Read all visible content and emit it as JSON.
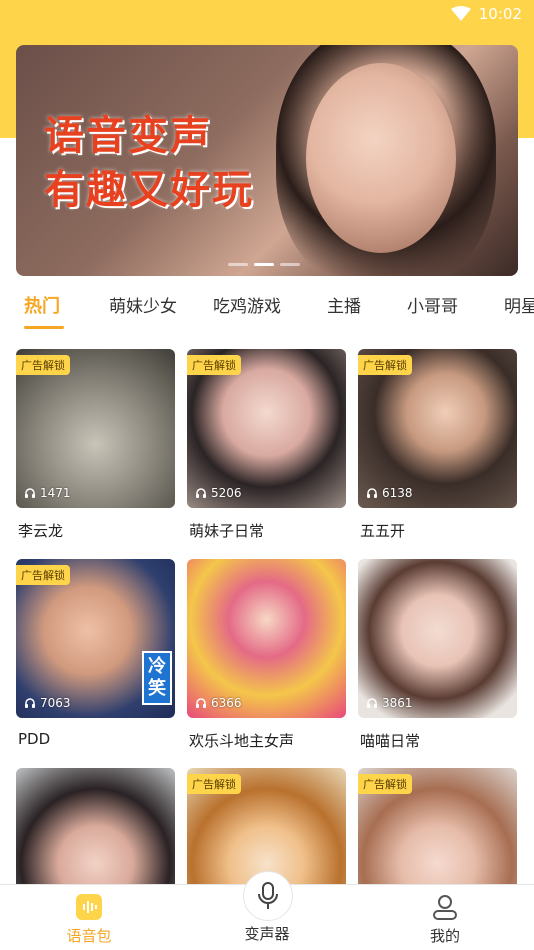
{
  "status_bar": {
    "time": "10:02"
  },
  "banner": {
    "line1": "语音变声",
    "line2": "有趣又好玩"
  },
  "tabs": [
    {
      "label": "热门",
      "active": true
    },
    {
      "label": "萌妹少女"
    },
    {
      "label": "吃鸡游戏"
    },
    {
      "label": "主播"
    },
    {
      "label": "小哥哥"
    },
    {
      "label": "明星"
    }
  ],
  "grid": [
    {
      "title": "李云龙",
      "count": "1471",
      "badge": "广告解锁"
    },
    {
      "title": "萌妹子日常",
      "count": "5206",
      "badge": "广告解锁"
    },
    {
      "title": "五五开",
      "count": "6138",
      "badge": "广告解锁"
    },
    {
      "title": "PDD",
      "count": "7063",
      "badge": "广告解锁",
      "overlay": "冷笑"
    },
    {
      "title": "欢乐斗地主女声",
      "count": "6366",
      "badge": ""
    },
    {
      "title": "喵喵日常",
      "count": "3861",
      "badge": ""
    },
    {
      "title": "",
      "count": "",
      "badge": ""
    },
    {
      "title": "",
      "count": "",
      "badge": "广告解锁"
    },
    {
      "title": "",
      "count": "",
      "badge": "广告解锁"
    }
  ],
  "bottom_nav": [
    {
      "label": "语音包",
      "icon": "voice-pack-icon",
      "active": true
    },
    {
      "label": "变声器",
      "icon": "microphone-icon"
    },
    {
      "label": "我的",
      "icon": "user-icon"
    }
  ],
  "colors": {
    "accent": "#f5a623",
    "brand_yellow": "#fdd44a",
    "badge_text": "#5a3b00"
  }
}
